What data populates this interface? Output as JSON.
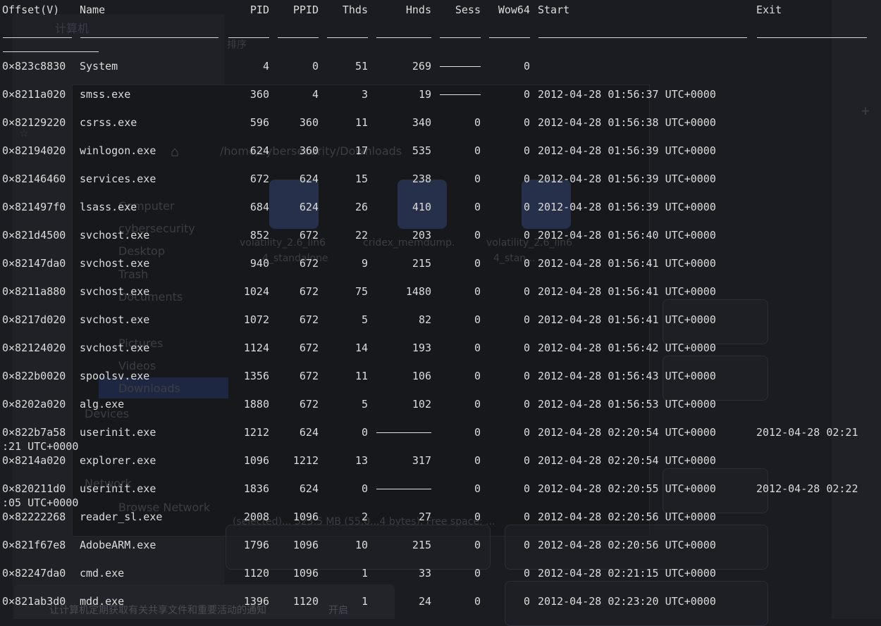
{
  "columns": {
    "offset": "Offset(V)",
    "name": "Name",
    "pid": "PID",
    "ppid": "PPID",
    "thds": "Thds",
    "hnds": "Hnds",
    "sess": "Sess",
    "wow64": "Wow64",
    "start": "Start",
    "exit": "Exit"
  },
  "rows": [
    {
      "offset": "0×823c8830",
      "name": "System",
      "pid": "4",
      "ppid": "0",
      "thds": "51",
      "hnds": "269",
      "sess": "",
      "wow64": "0",
      "start": "",
      "exit": ""
    },
    {
      "offset": "0×8211a020",
      "name": "smss.exe",
      "pid": "360",
      "ppid": "4",
      "thds": "3",
      "hnds": "19",
      "sess": "",
      "wow64": "0",
      "start": "2012-04-28 01:56:37 UTC+0000",
      "exit": ""
    },
    {
      "offset": "0×82129220",
      "name": "csrss.exe",
      "pid": "596",
      "ppid": "360",
      "thds": "11",
      "hnds": "340",
      "sess": "0",
      "wow64": "0",
      "start": "2012-04-28 01:56:38 UTC+0000",
      "exit": ""
    },
    {
      "offset": "0×82194020",
      "name": "winlogon.exe",
      "pid": "624",
      "ppid": "360",
      "thds": "17",
      "hnds": "535",
      "sess": "0",
      "wow64": "0",
      "start": "2012-04-28 01:56:39 UTC+0000",
      "exit": ""
    },
    {
      "offset": "0×82146460",
      "name": "services.exe",
      "pid": "672",
      "ppid": "624",
      "thds": "15",
      "hnds": "238",
      "sess": "0",
      "wow64": "0",
      "start": "2012-04-28 01:56:39 UTC+0000",
      "exit": ""
    },
    {
      "offset": "0×821497f0",
      "name": "lsass.exe",
      "pid": "684",
      "ppid": "624",
      "thds": "26",
      "hnds": "410",
      "sess": "0",
      "wow64": "0",
      "start": "2012-04-28 01:56:39 UTC+0000",
      "exit": ""
    },
    {
      "offset": "0×821d4500",
      "name": "svchost.exe",
      "pid": "852",
      "ppid": "672",
      "thds": "22",
      "hnds": "203",
      "sess": "0",
      "wow64": "0",
      "start": "2012-04-28 01:56:40 UTC+0000",
      "exit": ""
    },
    {
      "offset": "0×82147da0",
      "name": "svchost.exe",
      "pid": "940",
      "ppid": "672",
      "thds": "9",
      "hnds": "215",
      "sess": "0",
      "wow64": "0",
      "start": "2012-04-28 01:56:41 UTC+0000",
      "exit": ""
    },
    {
      "offset": "0×8211a880",
      "name": "svchost.exe",
      "pid": "1024",
      "ppid": "672",
      "thds": "75",
      "hnds": "1480",
      "sess": "0",
      "wow64": "0",
      "start": "2012-04-28 01:56:41 UTC+0000",
      "exit": ""
    },
    {
      "offset": "0×8217d020",
      "name": "svchost.exe",
      "pid": "1072",
      "ppid": "672",
      "thds": "5",
      "hnds": "82",
      "sess": "0",
      "wow64": "0",
      "start": "2012-04-28 01:56:41 UTC+0000",
      "exit": ""
    },
    {
      "offset": "0×82124020",
      "name": "svchost.exe",
      "pid": "1124",
      "ppid": "672",
      "thds": "14",
      "hnds": "193",
      "sess": "0",
      "wow64": "0",
      "start": "2012-04-28 01:56:42 UTC+0000",
      "exit": ""
    },
    {
      "offset": "0×822b0020",
      "name": "spoolsv.exe",
      "pid": "1356",
      "ppid": "672",
      "thds": "11",
      "hnds": "106",
      "sess": "0",
      "wow64": "0",
      "start": "2012-04-28 01:56:43 UTC+0000",
      "exit": ""
    },
    {
      "offset": "0×8202a020",
      "name": "alg.exe",
      "pid": "1880",
      "ppid": "672",
      "thds": "5",
      "hnds": "102",
      "sess": "0",
      "wow64": "0",
      "start": "2012-04-28 01:56:53 UTC+0000",
      "exit": ""
    },
    {
      "offset": "0×822b7a58",
      "name": "userinit.exe",
      "pid": "1212",
      "ppid": "624",
      "thds": "0",
      "hnds": "",
      "sess": "0",
      "wow64": "0",
      "start": "2012-04-28 02:20:54 UTC+0000",
      "exit": "2012-04-28 02:21",
      "exit_wrap": ":21 UTC+0000"
    },
    {
      "offset": "0×8214a020",
      "name": "explorer.exe",
      "pid": "1096",
      "ppid": "1212",
      "thds": "13",
      "hnds": "317",
      "sess": "0",
      "wow64": "0",
      "start": "2012-04-28 02:20:54 UTC+0000",
      "exit": ""
    },
    {
      "offset": "0×820211d0",
      "name": "userinit.exe",
      "pid": "1836",
      "ppid": "624",
      "thds": "0",
      "hnds": "",
      "sess": "0",
      "wow64": "0",
      "start": "2012-04-28 02:20:55 UTC+0000",
      "exit": "2012-04-28 02:22",
      "exit_wrap": ":05 UTC+0000"
    },
    {
      "offset": "0×82222268",
      "name": "reader_sl.exe",
      "pid": "2008",
      "ppid": "1096",
      "thds": "2",
      "hnds": "27",
      "sess": "0",
      "wow64": "0",
      "start": "2012-04-28 02:20:56 UTC+0000",
      "exit": ""
    },
    {
      "offset": "0×821f67e8",
      "name": "AdobeARM.exe",
      "pid": "1796",
      "ppid": "1096",
      "thds": "10",
      "hnds": "215",
      "sess": "0",
      "wow64": "0",
      "start": "2012-04-28 02:20:56 UTC+0000",
      "exit": ""
    },
    {
      "offset": "0×82247da0",
      "name": "cmd.exe",
      "pid": "1120",
      "ppid": "1096",
      "thds": "1",
      "hnds": "33",
      "sess": "0",
      "wow64": "0",
      "start": "2012-04-28 02:21:15 UTC+0000",
      "exit": ""
    },
    {
      "offset": "0×821ab3d0",
      "name": "mdd.exe",
      "pid": "1396",
      "ppid": "1120",
      "thds": "1",
      "hnds": "24",
      "sess": "0",
      "wow64": "0",
      "start": "2012-04-28 02:23:20 UTC+0000",
      "exit": ""
    }
  ],
  "background_ghost_text": {
    "computer_label": "计算机",
    "sort_label": "排序",
    "path_label": "/home/cybersecurity/Downloads",
    "sidebar_computer": "Computer",
    "sidebar_cybersecurity": "cybersecurity",
    "sidebar_desktop": "Desktop",
    "sidebar_trash": "Trash",
    "sidebar_documents": "Documents",
    "sidebar_pictures": "Pictures",
    "sidebar_videos": "Videos",
    "sidebar_downloads": "Downloads",
    "devices_label": "Devices",
    "network_label": "Network",
    "browse_network": "Browse Network",
    "file1": "volatility_2.6_lin6",
    "file1b": "4_standalone",
    "file2": "cridex_memdump.",
    "file3": "volatility_2.6_lin6",
    "file3b": "4_stan...",
    "status_text": "(selected)... 523.5 MB (55,0...4 bytes), Free space: ...",
    "notice_text": "让计算机定期获取有关共享文件和重要活动的通知",
    "notice_action": "开启"
  }
}
